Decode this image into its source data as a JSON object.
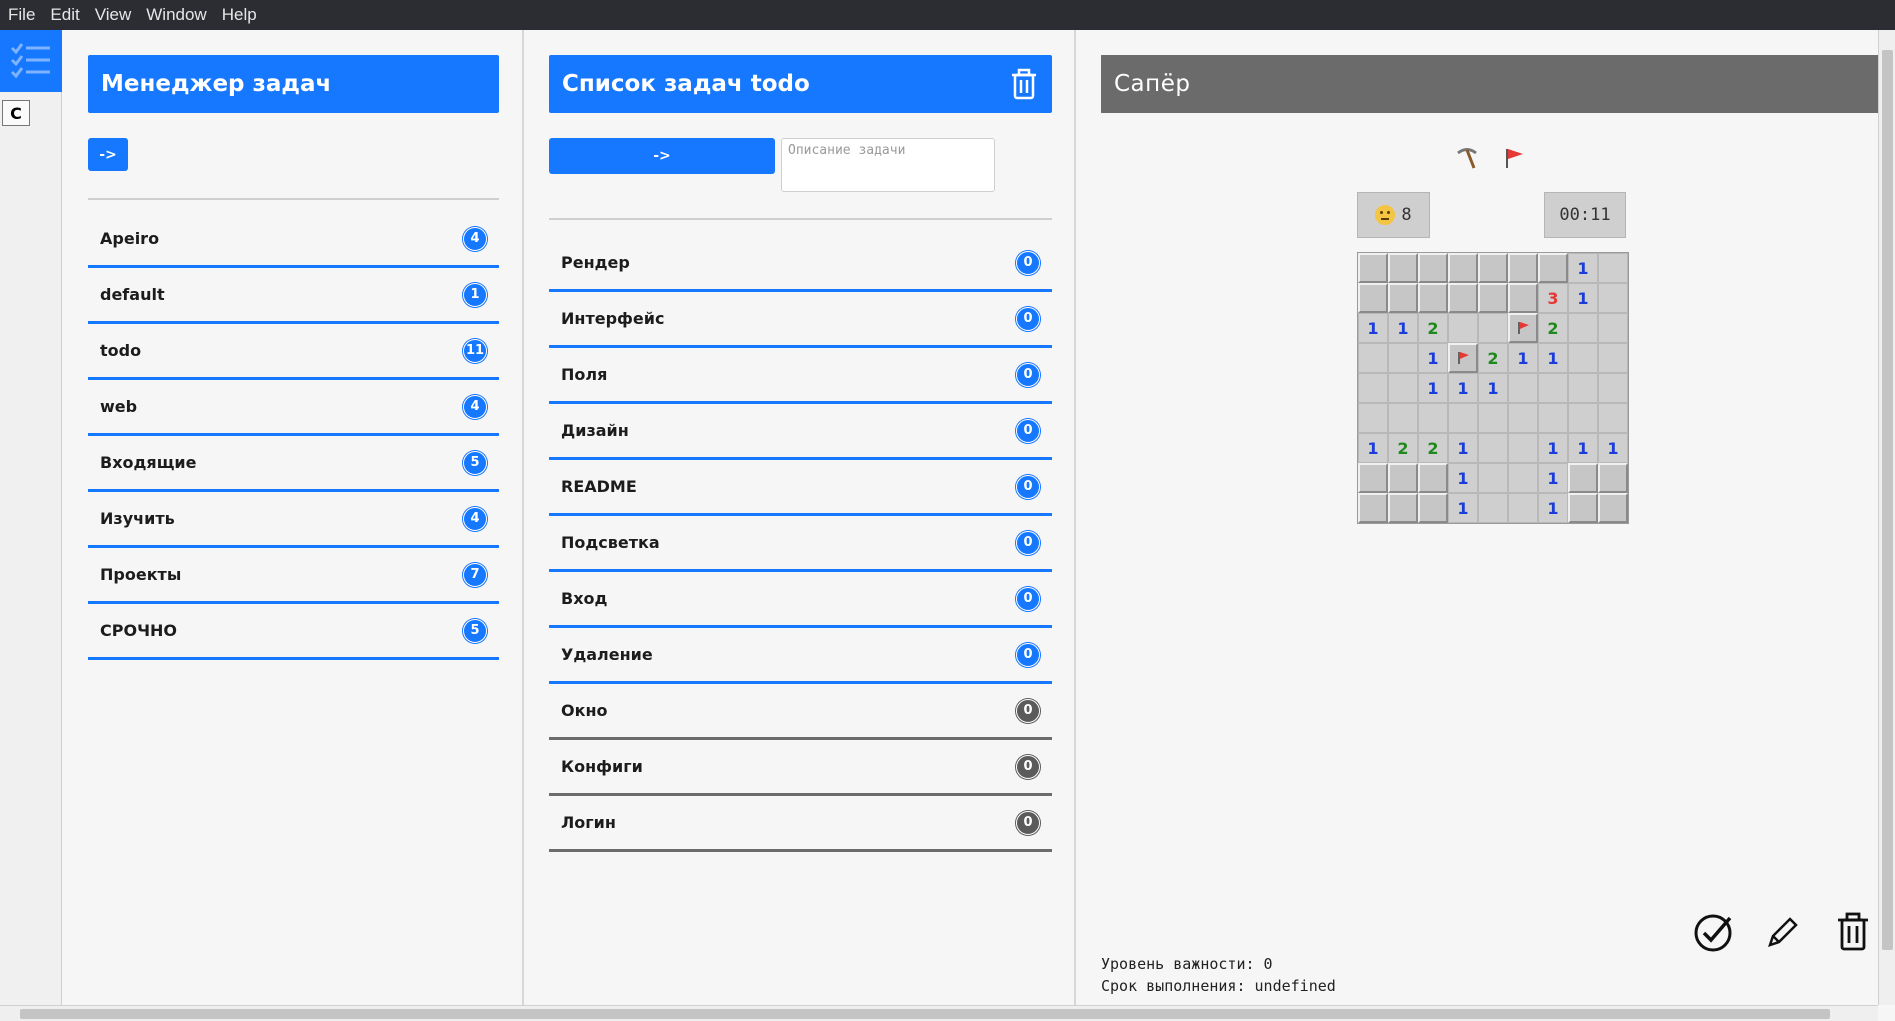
{
  "menu": [
    "File",
    "Edit",
    "View",
    "Window",
    "Help"
  ],
  "rail": {
    "c_button": "C"
  },
  "managers": {
    "title": "Менеджер задач",
    "arrow": "->",
    "items": [
      {
        "label": "Apeiro",
        "count": "4"
      },
      {
        "label": "default",
        "count": "1"
      },
      {
        "label": "todo",
        "count": "11"
      },
      {
        "label": "web",
        "count": "4"
      },
      {
        "label": "Входящие",
        "count": "5"
      },
      {
        "label": "Изучить",
        "count": "4"
      },
      {
        "label": "Проекты",
        "count": "7"
      },
      {
        "label": "СРОЧНО",
        "count": "5"
      }
    ]
  },
  "tasks": {
    "title": "Список задач todo",
    "arrow": "->",
    "description_placeholder": "Описание задачи",
    "items": [
      {
        "label": "Рендер",
        "count": "0",
        "status": "blue"
      },
      {
        "label": "Интерфейс",
        "count": "0",
        "status": "blue"
      },
      {
        "label": "Поля",
        "count": "0",
        "status": "blue"
      },
      {
        "label": "Дизайн",
        "count": "0",
        "status": "blue"
      },
      {
        "label": "README",
        "count": "0",
        "status": "blue"
      },
      {
        "label": "Подсветка",
        "count": "0",
        "status": "blue"
      },
      {
        "label": "Вход",
        "count": "0",
        "status": "blue"
      },
      {
        "label": "Удаление",
        "count": "0",
        "status": "blue"
      },
      {
        "label": "Окно",
        "count": "0",
        "status": "gray"
      },
      {
        "label": "Конфиги",
        "count": "0",
        "status": "gray"
      },
      {
        "label": "Логин",
        "count": "0",
        "status": "gray"
      }
    ]
  },
  "detail": {
    "title": "Сапёр",
    "mines_left": "8",
    "timer": "00:11",
    "board": [
      [
        "c",
        "c",
        "c",
        "c",
        "c",
        "c",
        "c",
        "1",
        "o"
      ],
      [
        "c",
        "c",
        "c",
        "c",
        "c",
        "c",
        "3",
        "1",
        "o"
      ],
      [
        "1",
        "1",
        "2",
        "o",
        "o",
        "f",
        "2",
        "o",
        "o"
      ],
      [
        "o",
        "o",
        "1",
        "f",
        "2",
        "1",
        "1",
        "o",
        "o"
      ],
      [
        "o",
        "o",
        "1",
        "1",
        "1",
        "o",
        "o",
        "o",
        "o"
      ],
      [
        "o",
        "o",
        "o",
        "o",
        "o",
        "o",
        "o",
        "o",
        "o"
      ],
      [
        "1",
        "2",
        "2",
        "1",
        "o",
        "o",
        "1",
        "1",
        "1"
      ],
      [
        "c",
        "c",
        "c",
        "1",
        "o",
        "o",
        "1",
        "c",
        "c"
      ],
      [
        "c",
        "c",
        "c",
        "1",
        "o",
        "o",
        "1",
        "c",
        "c"
      ]
    ],
    "importance": "Уровень важности: 0",
    "deadline": "Срок выполнения: undefined"
  },
  "colors": {
    "accent": "#1677ff",
    "menubar": "#2b2d33",
    "header_gray": "#6b6b6b"
  }
}
